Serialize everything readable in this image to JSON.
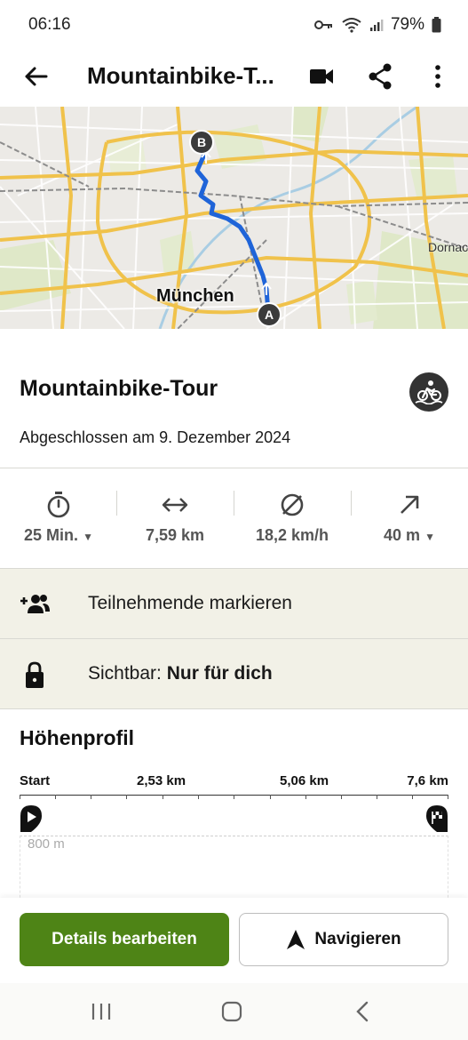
{
  "status_bar": {
    "time": "06:16",
    "battery": "79%"
  },
  "app_bar": {
    "title": "Mountainbike-T...",
    "icons": [
      "back-arrow-icon",
      "video-camera-icon",
      "share-icon",
      "more-vert-icon"
    ]
  },
  "map": {
    "city_label": "München",
    "edge_label": "Dornac",
    "start_marker": "A",
    "end_marker": "B",
    "route_color": "#1f64d8"
  },
  "tour": {
    "title": "Mountainbike-Tour",
    "completed_text": "Abgeschlossen am 9. Dezember 2024",
    "sport_icon": "mountain-bike-icon"
  },
  "stats": {
    "duration": "25 Min.",
    "distance": "7,59 km",
    "avg_speed": "18,2 km/h",
    "elevation": "40 m"
  },
  "actions": {
    "mark_participants": "Teilnehmende markieren",
    "visibility_prefix": "Sichtbar:",
    "visibility_value": "Nur für dich"
  },
  "elevation_profile": {
    "title": "Höhenprofil",
    "axis_labels": [
      "Start",
      "2,53 km",
      "5,06 km",
      "7,6 km"
    ],
    "y_label": "800 m"
  },
  "buttons": {
    "edit_details": "Details bearbeiten",
    "navigate": "Navigieren"
  },
  "colors": {
    "primary_green": "#4e8416",
    "row_background": "#f2f1e7"
  }
}
